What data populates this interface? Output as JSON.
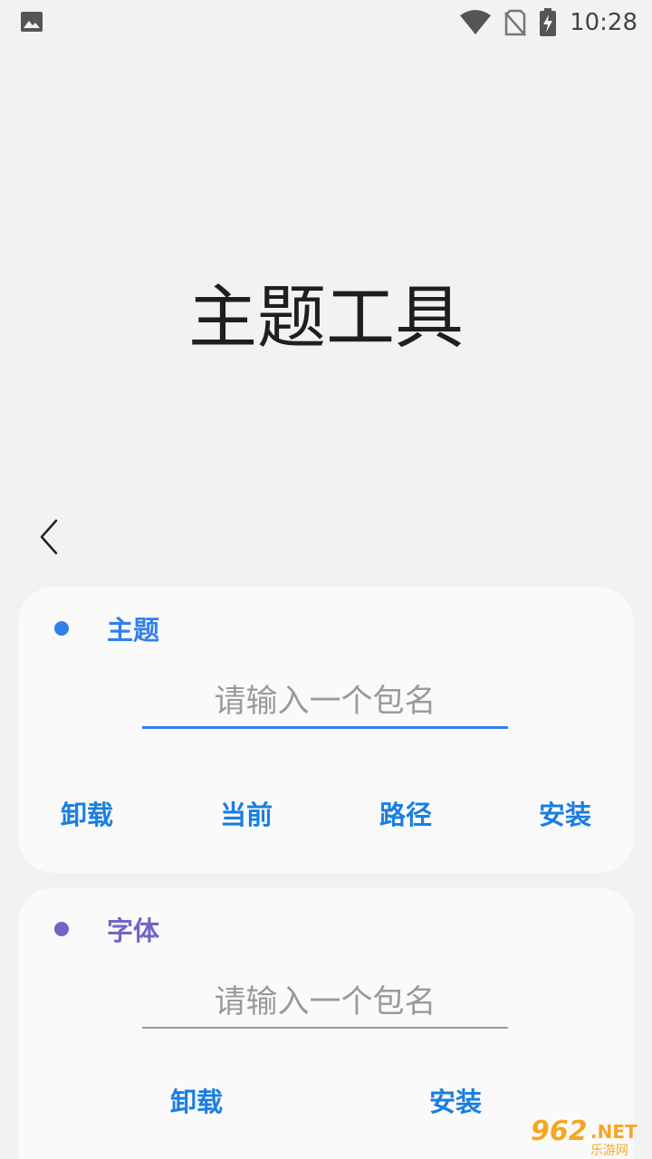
{
  "status_bar": {
    "time": "10:28",
    "icons": [
      "gallery-icon",
      "wifi-icon",
      "no-sim-icon",
      "battery-charging-icon"
    ]
  },
  "app": {
    "title": "主题工具",
    "back_icon": "chevron-left-icon"
  },
  "theme_card": {
    "title": "主题",
    "dot_color": "#2f80ed",
    "input_placeholder": "请输入一个包名",
    "input_value": "",
    "underline_color": "#2f80ed",
    "buttons": {
      "uninstall": "卸载",
      "current": "当前",
      "path": "路径",
      "install": "安装"
    }
  },
  "font_card": {
    "title": "字体",
    "dot_color": "#7066c8",
    "input_placeholder": "请输入一个包名",
    "input_value": "",
    "underline_color": "#999999",
    "buttons": {
      "uninstall": "卸载",
      "install": "安装"
    }
  },
  "watermark": {
    "number": "962",
    "suffix": ".NET",
    "label": "乐游网"
  },
  "colors": {
    "background": "#f2f2f2",
    "card": "#fafafa",
    "button_text": "#1a7ee0",
    "theme_title": "#2f80ed",
    "font_title": "#7066c8"
  }
}
